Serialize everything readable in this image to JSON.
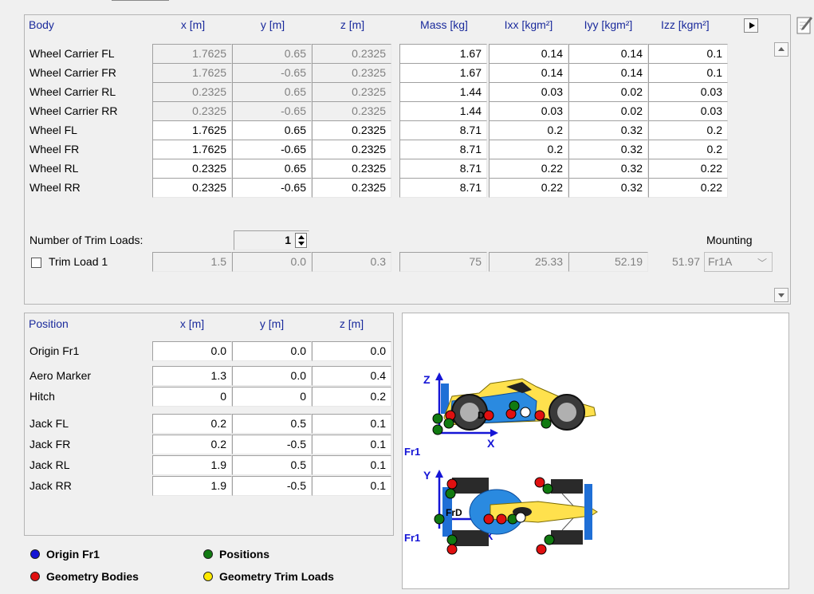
{
  "colors": {
    "header_text": "#1a2a9c",
    "blue": "#1515d6",
    "red": "#e01010",
    "green": "#117a11",
    "yellow": "#ffea00"
  },
  "body_table": {
    "headers": {
      "name": "Body",
      "x": "x [m]",
      "y": "y [m]",
      "z": "z [m]",
      "mass": "Mass [kg]",
      "ixx": "Ixx [kgm²]",
      "iyy": "Iyy [kgm²]",
      "izz": "Izz [kgm²]"
    },
    "rows": [
      {
        "name": "Wheel Carrier FL",
        "x": "1.7625",
        "y": "0.65",
        "z": "0.2325",
        "mass": "1.67",
        "ixx": "0.14",
        "iyy": "0.14",
        "izz": "0.1",
        "pos_readonly": true
      },
      {
        "name": "Wheel Carrier FR",
        "x": "1.7625",
        "y": "-0.65",
        "z": "0.2325",
        "mass": "1.67",
        "ixx": "0.14",
        "iyy": "0.14",
        "izz": "0.1",
        "pos_readonly": true
      },
      {
        "name": "Wheel Carrier RL",
        "x": "0.2325",
        "y": "0.65",
        "z": "0.2325",
        "mass": "1.44",
        "ixx": "0.03",
        "iyy": "0.02",
        "izz": "0.03",
        "pos_readonly": true
      },
      {
        "name": "Wheel Carrier RR",
        "x": "0.2325",
        "y": "-0.65",
        "z": "0.2325",
        "mass": "1.44",
        "ixx": "0.03",
        "iyy": "0.02",
        "izz": "0.03",
        "pos_readonly": true
      },
      {
        "name": "Wheel FL",
        "x": "1.7625",
        "y": "0.65",
        "z": "0.2325",
        "mass": "8.71",
        "ixx": "0.2",
        "iyy": "0.32",
        "izz": "0.2",
        "pos_readonly": false
      },
      {
        "name": "Wheel FR",
        "x": "1.7625",
        "y": "-0.65",
        "z": "0.2325",
        "mass": "8.71",
        "ixx": "0.2",
        "iyy": "0.32",
        "izz": "0.2",
        "pos_readonly": false
      },
      {
        "name": "Wheel RL",
        "x": "0.2325",
        "y": "0.65",
        "z": "0.2325",
        "mass": "8.71",
        "ixx": "0.22",
        "iyy": "0.32",
        "izz": "0.22",
        "pos_readonly": false
      },
      {
        "name": "Wheel RR",
        "x": "0.2325",
        "y": "-0.65",
        "z": "0.2325",
        "mass": "8.71",
        "ixx": "0.22",
        "iyy": "0.32",
        "izz": "0.22",
        "pos_readonly": false
      }
    ],
    "trim_loads_label": "Number of Trim Loads:",
    "trim_loads_count": "1",
    "mounting_label": "Mounting",
    "trim_load": {
      "name": "Trim Load 1",
      "checked": false,
      "x": "1.5",
      "y": "0.0",
      "z": "0.3",
      "mass": "75",
      "ixx": "25.33",
      "iyy": "52.19",
      "izz": "51.97",
      "mounting": "Fr1A"
    }
  },
  "position_table": {
    "headers": {
      "name": "Position",
      "x": "x [m]",
      "y": "y [m]",
      "z": "z [m]"
    },
    "rows": [
      {
        "name": "Origin Fr1",
        "x": "0.0",
        "y": "0.0",
        "z": "0.0"
      },
      {
        "name": "Aero Marker",
        "x": "1.3",
        "y": "0.0",
        "z": "0.4"
      },
      {
        "name": "Hitch",
        "x": "0",
        "y": "0",
        "z": "0.2"
      },
      {
        "name": "Jack FL",
        "x": "0.2",
        "y": "0.5",
        "z": "0.1"
      },
      {
        "name": "Jack FR",
        "x": "0.2",
        "y": "-0.5",
        "z": "0.1"
      },
      {
        "name": "Jack RL",
        "x": "1.9",
        "y": "0.5",
        "z": "0.1"
      },
      {
        "name": "Jack RR",
        "x": "1.9",
        "y": "-0.5",
        "z": "0.1"
      }
    ]
  },
  "legend": {
    "origin": "Origin Fr1",
    "positions": "Positions",
    "geometry_bodies": "Geometry Bodies",
    "geometry_trim_loads": "Geometry Trim Loads"
  },
  "diagram": {
    "side_axis_z": "Z",
    "side_axis_x": "X",
    "side_frame": "Fr1",
    "side_marker": "D",
    "top_axis_y": "Y",
    "top_axis_x": "X",
    "top_frame": "Fr1",
    "top_marker": "FrD"
  },
  "icons": {
    "edit": "edit-pencil-icon",
    "scroll_up": "chevron-up-icon",
    "scroll_down": "chevron-down-icon",
    "more_columns": "triangle-right-icon",
    "spinner": "spin-updown-icon",
    "dropdown": "chevron-down-icon"
  }
}
